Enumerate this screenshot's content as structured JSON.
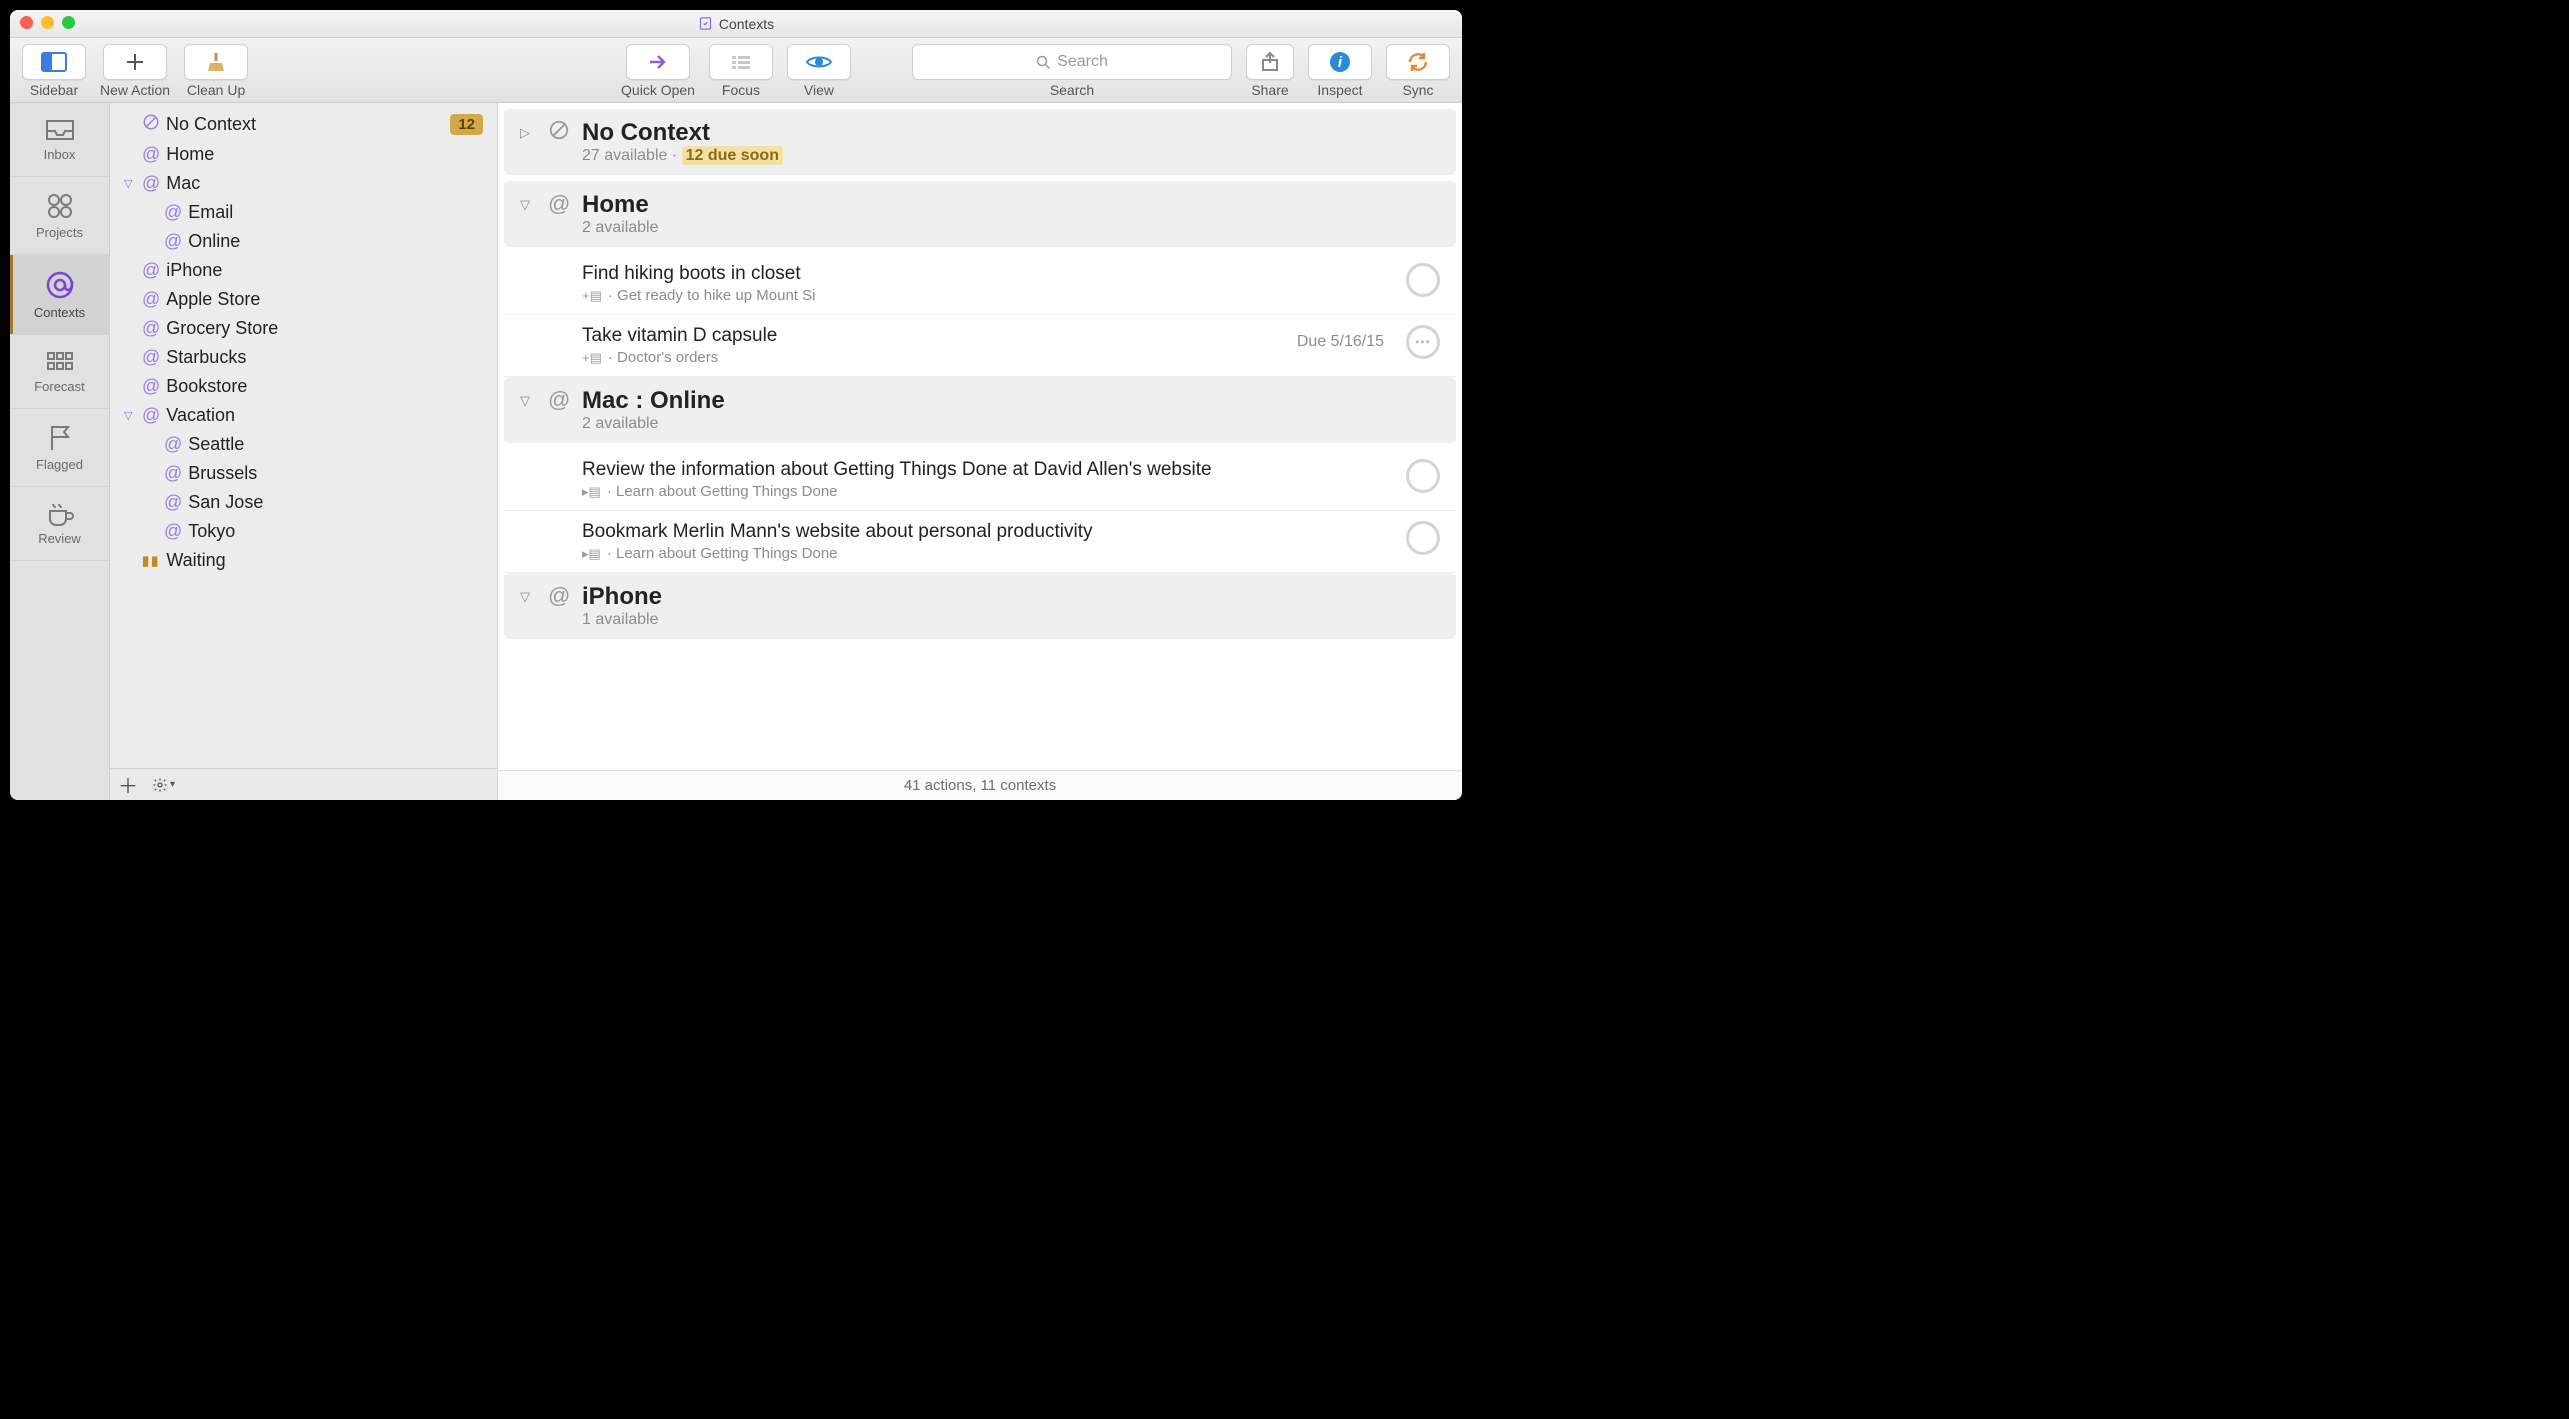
{
  "window": {
    "title": "Contexts"
  },
  "toolbar": {
    "left": {
      "sidebar": "Sidebar",
      "new_action": "New Action",
      "clean_up": "Clean Up"
    },
    "center": {
      "quick_open": "Quick Open",
      "focus": "Focus",
      "view": "View"
    },
    "right": {
      "search_placeholder": "Search",
      "search_label": "Search",
      "share": "Share",
      "inspect": "Inspect",
      "sync": "Sync"
    }
  },
  "rail": {
    "inbox": "Inbox",
    "projects": "Projects",
    "contexts": "Contexts",
    "forecast": "Forecast",
    "flagged": "Flagged",
    "review": "Review"
  },
  "contexts_sidebar": {
    "items": [
      {
        "name": "No Context",
        "badge": "12",
        "icon": "nocontext",
        "indent": 0
      },
      {
        "name": "Home",
        "icon": "at",
        "indent": 0
      },
      {
        "name": "Mac",
        "icon": "at",
        "indent": 0,
        "expanded": true
      },
      {
        "name": "Email",
        "icon": "at",
        "indent": 1
      },
      {
        "name": "Online",
        "icon": "at",
        "indent": 1
      },
      {
        "name": "iPhone",
        "icon": "at",
        "indent": 0
      },
      {
        "name": "Apple Store",
        "icon": "at",
        "indent": 0
      },
      {
        "name": "Grocery Store",
        "icon": "at",
        "indent": 0
      },
      {
        "name": "Starbucks",
        "icon": "at",
        "indent": 0
      },
      {
        "name": "Bookstore",
        "icon": "at",
        "indent": 0
      },
      {
        "name": "Vacation",
        "icon": "at",
        "indent": 0,
        "expanded": true
      },
      {
        "name": "Seattle",
        "icon": "at",
        "indent": 1
      },
      {
        "name": "Brussels",
        "icon": "at",
        "indent": 1
      },
      {
        "name": "San Jose",
        "icon": "at",
        "indent": 1
      },
      {
        "name": "Tokyo",
        "icon": "at",
        "indent": 1
      },
      {
        "name": "Waiting",
        "icon": "pause",
        "indent": 0
      }
    ]
  },
  "main": {
    "sections": [
      {
        "title": "No Context",
        "sub_available": "27 available",
        "sub_due": "12 due soon",
        "icon": "nocontext",
        "disclosure": "right",
        "tasks": []
      },
      {
        "title": "Home",
        "sub_available": "2 available",
        "icon": "at",
        "disclosure": "down",
        "tasks": [
          {
            "title": "Find hiking boots in closet",
            "project": "Get ready to hike up Mount Si",
            "proj_icon": "plus"
          },
          {
            "title": "Take vitamin D capsule",
            "project": "Doctor's orders",
            "proj_icon": "plus",
            "due": "Due 5/16/15",
            "repeat": true
          }
        ]
      },
      {
        "title": "Mac : Online",
        "sub_available": "2 available",
        "icon": "at",
        "disclosure": "down",
        "tasks": [
          {
            "title": "Review the information about Getting Things Done at David Allen's website",
            "project": "Learn about Getting Things Done",
            "proj_icon": "arrow"
          },
          {
            "title": "Bookmark Merlin Mann's website about personal productivity",
            "project": "Learn about Getting Things Done",
            "proj_icon": "arrow"
          }
        ]
      },
      {
        "title": "iPhone",
        "sub_available": "1 available",
        "icon": "at",
        "disclosure": "down",
        "tasks": []
      }
    ]
  },
  "statusbar": {
    "text": "41 actions, 11 contexts"
  }
}
